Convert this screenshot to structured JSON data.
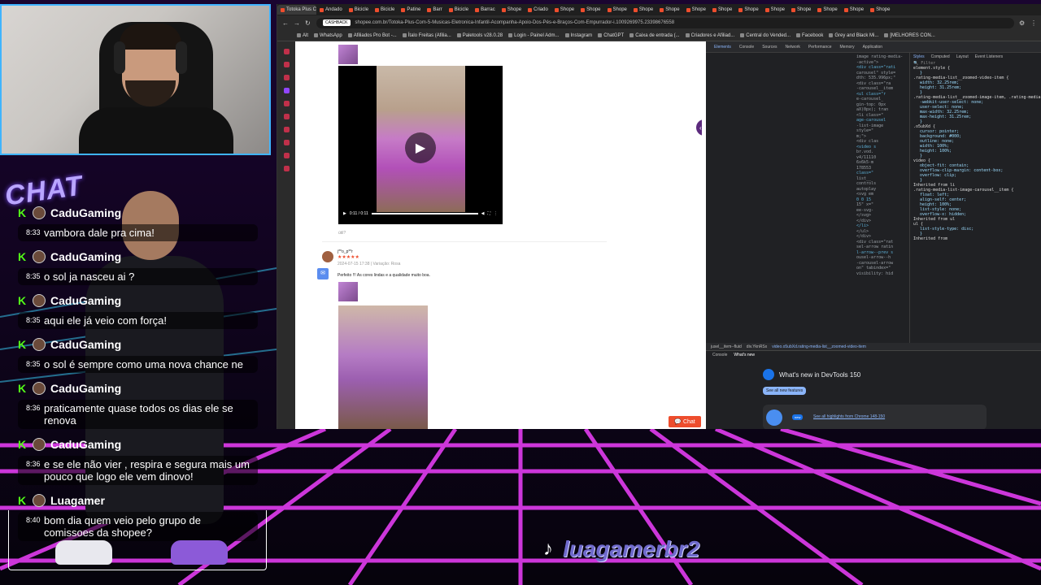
{
  "chat": {
    "logo": "CHAT",
    "messages": [
      {
        "user": "CaduGaming",
        "time": "8:33",
        "text": "vambora dale pra cima!"
      },
      {
        "user": "CaduGaming",
        "time": "8:35",
        "text": "o sol ja nasceu ai ?"
      },
      {
        "user": "CaduGaming",
        "time": "8:35",
        "text": "aqui ele já veio com força!"
      },
      {
        "user": "CaduGaming",
        "time": "8:35",
        "text": "o sol é sempre como uma nova chance ne"
      },
      {
        "user": "CaduGaming",
        "time": "8:36",
        "text": "praticamente quase todos os dias ele se renova"
      },
      {
        "user": "CaduGaming",
        "time": "8:36",
        "text": "e se ele não vier , respira e segura mais um pouco que logo ele vem dinovo!"
      },
      {
        "user": "Luagamer",
        "time": "8:40",
        "text": "bom dia quem veio pelo grupo de comissoes da shopee?"
      }
    ]
  },
  "browser": {
    "tabs": [
      "Totoka Plus C",
      "Andado",
      "Bicicle",
      "Bicicle",
      "Patine",
      "Barr",
      "Bicicle",
      "Barrac",
      "Shope",
      "Criado",
      "Shope",
      "Shope",
      "Shope",
      "Shope",
      "Shope",
      "Shope",
      "Shope",
      "Shope",
      "Shope",
      "Shope",
      "Shope",
      "Shope",
      "Shope"
    ],
    "url": "shopee.com.br/Totoka-Plus-Com-5-Musicas-Eletronica-Infantil-Acompanha-Apoio-Dos-Pés-e-Braços-Com-Empurrador-i.1009269975.23398676558",
    "cashback_label": "CASHBACK",
    "bookmarks": [
      "Alt",
      "WhatsApp",
      "Afiliados Pro Bot -...",
      "Ítalo Freitas (Afilia...",
      "Paletools v28.0.28",
      "Login - Painel Adm...",
      "Instagram",
      "ChatGPT",
      "Caixa de entrada (...",
      "Criadores e Afiliad...",
      "Central do Vended...",
      "Facebook",
      "Grey and Black Mi...",
      "[MELHORES CON..."
    ]
  },
  "product_page": {
    "video_time": "0:11 / 0:11",
    "likes_label": "útil?",
    "review": {
      "username": "j**o_p**r",
      "stars": "★★★★★",
      "date": "2024-07-15 17:38 | Variação: Rosa",
      "text": "Perfeito !!! As cores lindas e a qualidade muito boa."
    },
    "chat_button": "Chat",
    "chat_badge": "1",
    "side_badge": "$"
  },
  "devtools": {
    "tabs": [
      "Elements",
      "Console",
      "Sources",
      "Network",
      "Performance",
      "Memory",
      "Application"
    ],
    "active_tab": "Elements",
    "style_tabs": [
      "Styles",
      "Computed",
      "Layout",
      "Event Listeners"
    ],
    "filter_placeholder": "Filter",
    "dom_lines": [
      "image rating-media-",
      "-active\">",
      "<div class=\"rati",
      "carousel\" style=",
      "dth: 535.996px;\"",
      "<div class=\"ra",
      "-carousel__item",
      "<ul class=\"r",
      "e-carousel_",
      "gin-top: 0px",
      "aX(0px); tran",
      "<li class=\"",
      "age-carousel",
      "-list-image",
      "style=\"",
      "m;\">",
      "<div clas",
      "<video s",
      "br.vod.",
      "v4/11110",
      "6x6k5-m",
      "178553",
      "class=\"",
      "list__",
      "controls",
      "autoplay",
      "<svg em",
      "0 0 15",
      "15\" x=\"",
      "ee-svg-",
      "</svg>",
      "</div>",
      "</li>",
      "</ul>",
      "</div>",
      "<div class=\"rat",
      "sel-arrow ratin",
      "l-arrow--prev s",
      "ousel-arrow--h",
      "-carousel-arrow",
      "on\" tabindex=\"",
      "visibility: hid"
    ],
    "style_rules": [
      {
        "selector": "element.style {",
        "props": [
          "}"
        ]
      },
      {
        "selector": ".rating-media-list__zoomed-video-item {",
        "props": [
          "width: 32.25rem;",
          "height: 31.25rem;",
          "}"
        ]
      },
      {
        "selector": ".rating-media-list__zoomed-image-item, .rating-media-list__zoomed-video-item {",
        "props": [
          "-webkit-user-select: none;",
          "user-select: none;",
          "max-width: 32.25rem;",
          "max-height: 31.25rem;",
          "}"
        ]
      },
      {
        "selector": ".o5ubXd {",
        "props": [
          "cursor: pointer;",
          "background: #000;",
          "outline: none;",
          "width: 100%;",
          "height: 100%;",
          "}"
        ]
      },
      {
        "selector": "video {",
        "props": [
          "object-fit: contain;",
          "overflow-clip-margin: content-box;",
          "overflow: clip;",
          "}"
        ]
      },
      {
        "selector": "Inherited from li",
        "props": []
      },
      {
        "selector": ".rating-media-list-image-carousel__item {",
        "props": [
          "float: left;",
          "align-self: center;",
          "height: 100%;",
          "list-style: none;",
          "overflow-x: hidden;"
        ]
      },
      {
        "selector": "Inherited from ul",
        "props": []
      },
      {
        "selector": "ul {",
        "props": [
          "list-style-type: disc;",
          "}"
        ]
      },
      {
        "selector": "Inherited from",
        "props": []
      }
    ],
    "style_source": "158.ba37c48...2023.css:2",
    "user_agent_label": "user agent stylesheet",
    "breadcrumbs": [
      "jusel__item--fluid",
      "div.YknRSx",
      "video.o5ubXd.rating-media-list__zoomed-video-item"
    ],
    "drawer_tabs": [
      "Console",
      "What's new"
    ],
    "whats_new_title": "What's new in DevTools 150",
    "see_all": "See all new features",
    "card_badge": "new",
    "card_link": "See all highlights from Chrome 148-150"
  },
  "tiktok_handle": "luagamerbr2"
}
